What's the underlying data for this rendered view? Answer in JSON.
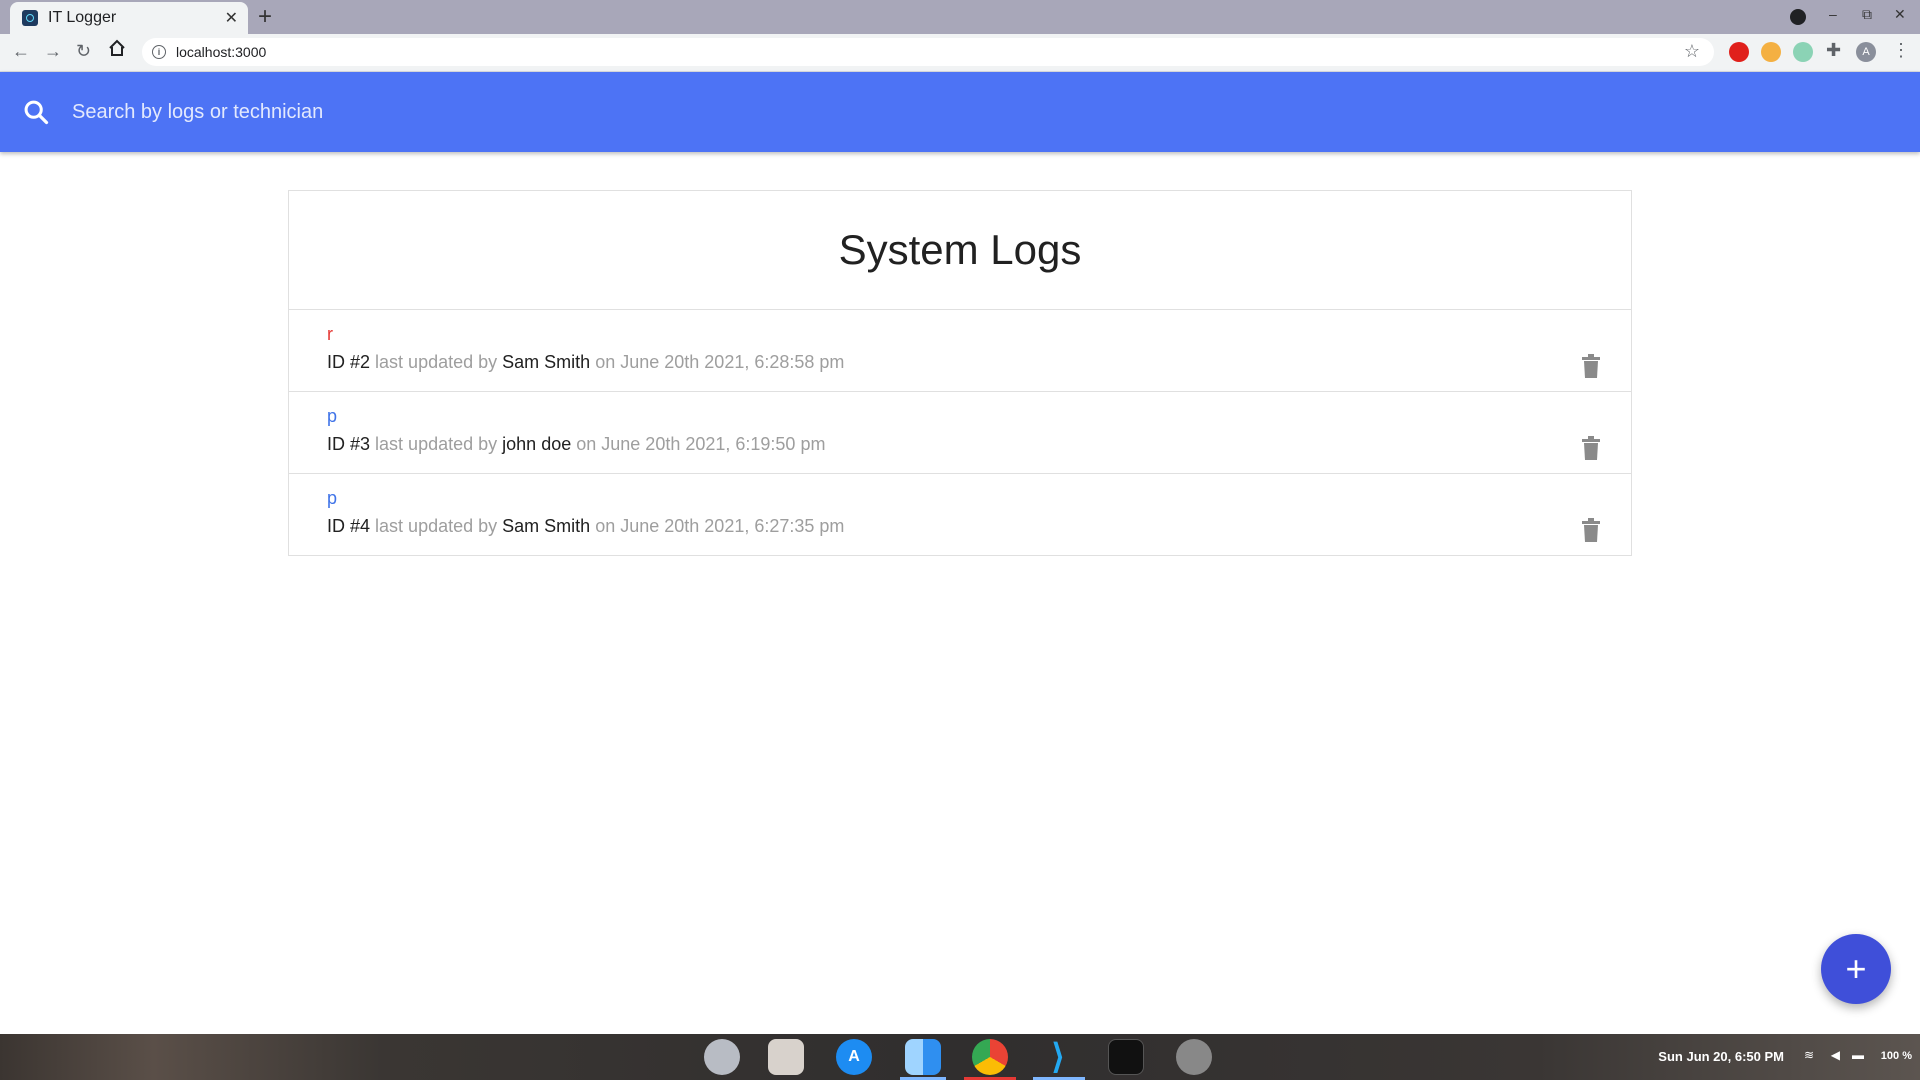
{
  "browser": {
    "tab_title": "IT Logger",
    "tab_close": "✕",
    "new_tab": "+",
    "url": "localhost:3000",
    "win_minimize": "–",
    "win_restore": "⧉",
    "win_close": "✕",
    "profile_initial": "A"
  },
  "search": {
    "placeholder": "Search by logs or technician"
  },
  "logs": {
    "title": "System Logs",
    "items": [
      {
        "message": "r",
        "attention": true,
        "id_label": "ID #2",
        "updated_by_text": "last updated by",
        "tech": "Sam Smith",
        "date_text": "on June 20th 2021, 6:28:58 pm"
      },
      {
        "message": "p",
        "attention": false,
        "id_label": "ID #3",
        "updated_by_text": "last updated by",
        "tech": "john doe",
        "date_text": "on June 20th 2021, 6:19:50 pm"
      },
      {
        "message": "p",
        "attention": false,
        "id_label": "ID #4",
        "updated_by_text": "last updated by",
        "tech": "Sam Smith",
        "date_text": "on June 20th 2021, 6:27:35 pm"
      }
    ]
  },
  "fab": {
    "label": "+"
  },
  "taskbar": {
    "clock": "Sun Jun 20,  6:50 PM",
    "battery": "100 %"
  },
  "colors": {
    "nav": "#4d73f5",
    "attention": "#e53935",
    "normal_link": "#3f73e8",
    "fab": "#3f4fd9"
  }
}
